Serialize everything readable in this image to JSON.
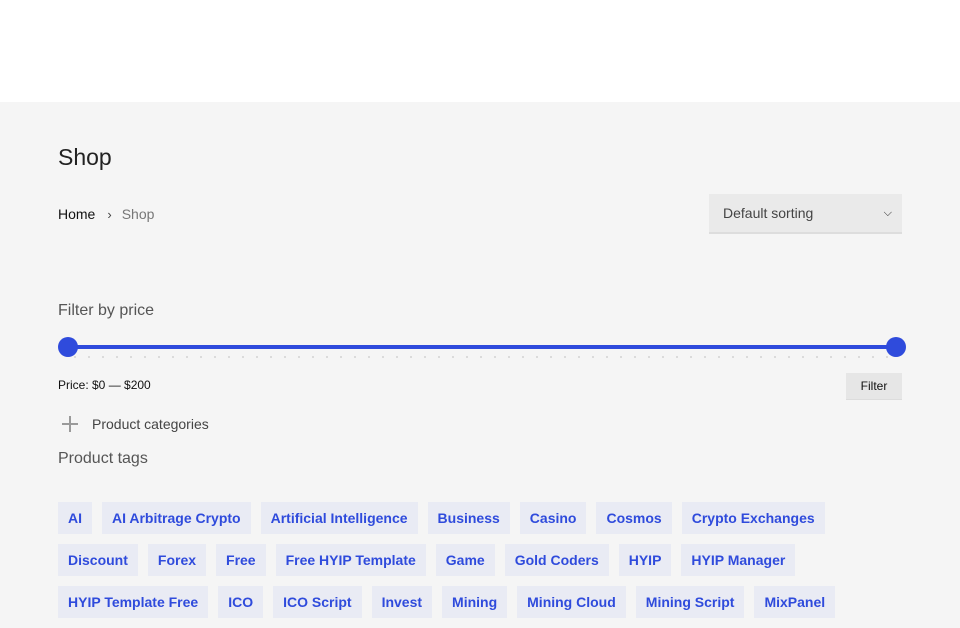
{
  "page": {
    "title": "Shop"
  },
  "breadcrumb": {
    "home": "Home",
    "separator": "›",
    "current": "Shop"
  },
  "sorting": {
    "selected": "Default sorting"
  },
  "price_filter": {
    "title": "Filter by price",
    "label": "Price: $0 — $200",
    "button": "Filter",
    "min": 0,
    "max": 200,
    "range_start_fraction": 0,
    "range_end_fraction": 1
  },
  "categories": {
    "label": "Product categories"
  },
  "tags": {
    "title": "Product tags",
    "rows": [
      [
        "AI",
        "AI Arbitrage Crypto",
        "Artificial Intelligence",
        "Business",
        "Casino",
        "Cosmos",
        "Crypto Exchanges"
      ],
      [
        "Discount",
        "Forex",
        "Free",
        "Free HYIP Template",
        "Game",
        "Gold Coders",
        "HYIP",
        "HYIP Manager"
      ],
      [
        "HYIP Template Free",
        "ICO",
        "ICO Script",
        "Invest",
        "Mining",
        "Mining Cloud",
        "Mining Script",
        "MixPanel"
      ]
    ]
  },
  "colors": {
    "accent": "#2f4bdc",
    "tag_bg": "#e9ebf4",
    "page_bg": "#f5f5f5"
  }
}
